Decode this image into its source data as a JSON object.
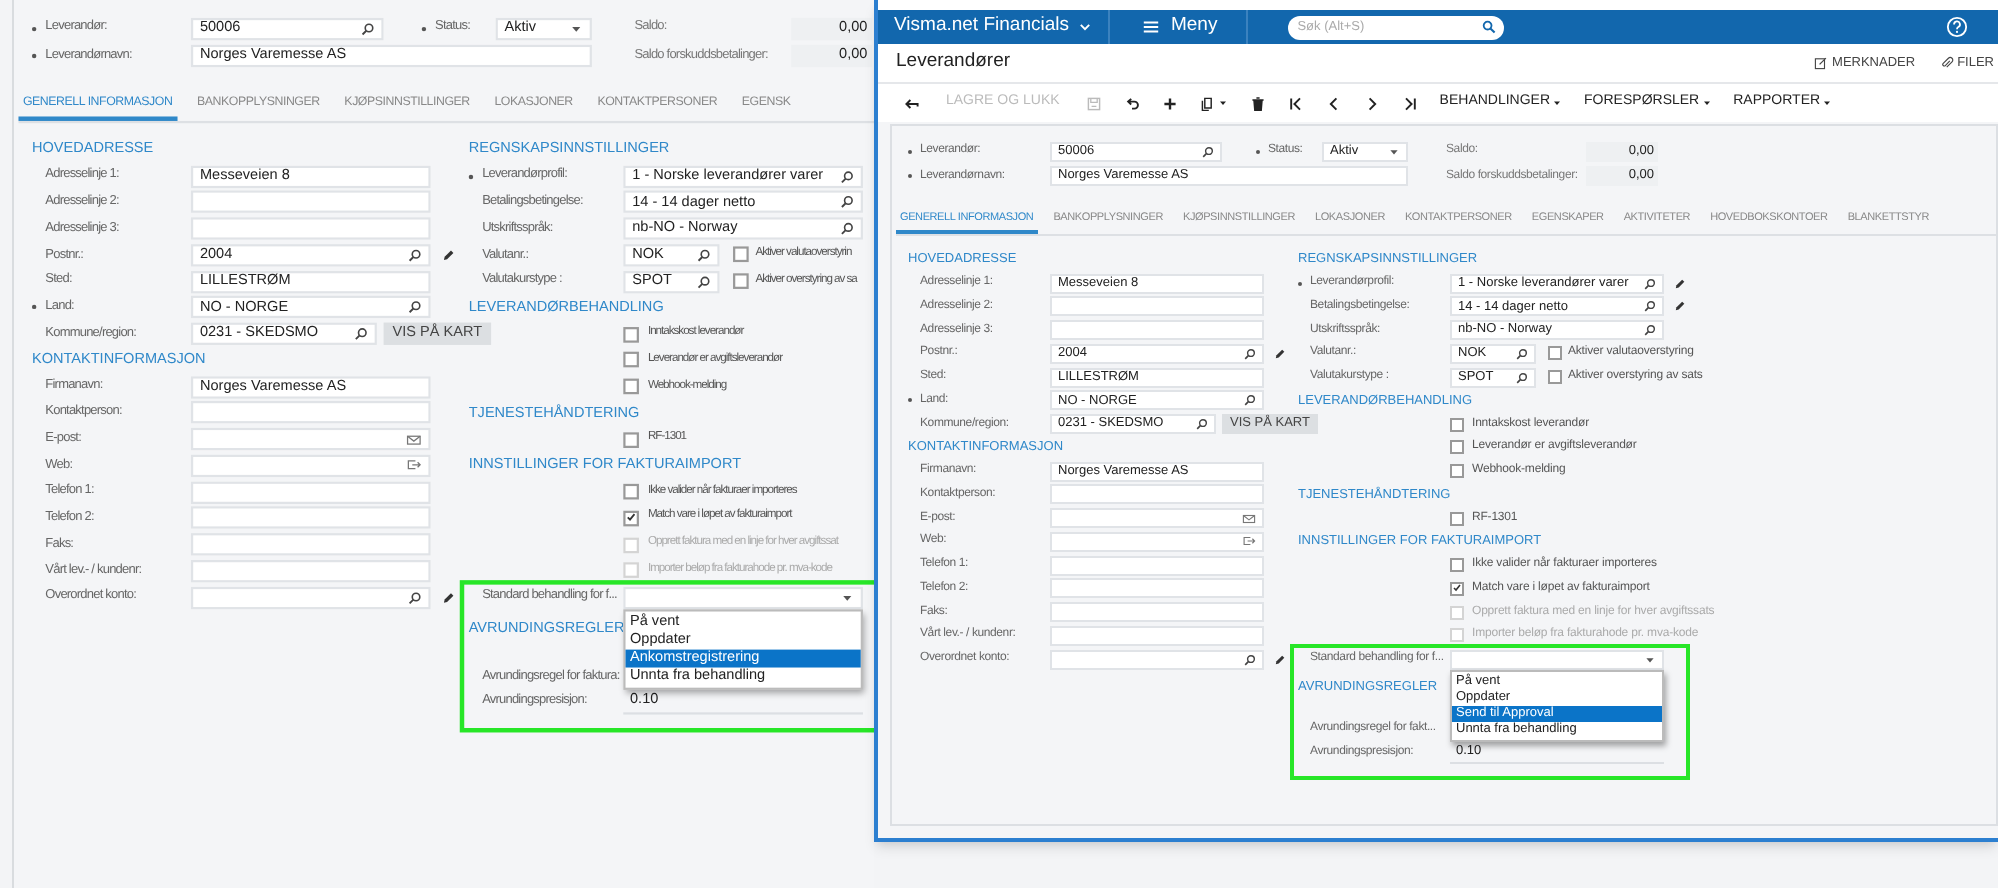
{
  "left_window": {
    "form": {
      "header": [
        [
          {
            "kind": "lookup",
            "label": "Leverandør:",
            "required": true,
            "value": "50006"
          },
          {
            "kind": "select",
            "label": "Status:",
            "required": true,
            "value": "Aktiv"
          },
          {
            "kind": "amount",
            "label": "Saldo:",
            "value": "0,00"
          }
        ],
        [
          {
            "kind": "wide",
            "label": "Leverandørnavn:",
            "required": true,
            "value": "Norges Varemesse AS"
          },
          {
            "kind": "amount",
            "label": "Saldo forskuddsbetalinger:",
            "value": "0,00"
          }
        ]
      ],
      "tabs": [
        {
          "label": "GENERELL INFORMASJON",
          "selected": true
        },
        {
          "label": "BANKOPPLYSNINGER",
          "selected": false
        },
        {
          "label": "KJØPSINNSTILLINGER",
          "selected": false
        },
        {
          "label": "LOKASJONER",
          "selected": false
        },
        {
          "label": "KONTAKTPERSONER",
          "selected": false
        },
        {
          "label": "EGENSK",
          "selected": false
        }
      ],
      "columns": [
        [
          {
            "kind": "title",
            "text": "HOVEDADRESSE"
          },
          {
            "kind": "text",
            "label": "Adresselinje 1:",
            "value": "Messeveien 8"
          },
          {
            "kind": "text",
            "label": "Adresselinje 2:"
          },
          {
            "kind": "text",
            "label": "Adresselinje 3:"
          },
          {
            "kind": "lookup",
            "label": "Postnr.:",
            "value": "2004",
            "edit": true
          },
          {
            "kind": "text",
            "label": "Sted:",
            "value": "LILLESTRØM"
          },
          {
            "kind": "lookup",
            "label": "Land:",
            "required": true,
            "value": "NO - NORGE"
          },
          {
            "kind": "lookup",
            "label": "Kommune/region:",
            "value": "0231 - SKEDSMO",
            "button": "VIS PÅ KART"
          },
          {
            "kind": "title",
            "text": "KONTAKTINFORMASJON"
          },
          {
            "kind": "text",
            "label": "Firmanavn:",
            "value": "Norges Varemesse AS"
          },
          {
            "kind": "text",
            "label": "Kontaktperson:"
          },
          {
            "kind": "email",
            "label": "E-post:"
          },
          {
            "kind": "web",
            "label": "Web:"
          },
          {
            "kind": "text",
            "label": "Telefon 1:"
          },
          {
            "kind": "text",
            "label": "Telefon 2:"
          },
          {
            "kind": "text",
            "label": "Faks:"
          },
          {
            "kind": "text",
            "label": "Vårt lev.- / kundenr:"
          },
          {
            "kind": "lookup",
            "label": "Overordnet konto:",
            "edit": true
          }
        ],
        [
          {
            "kind": "title",
            "text": "REGNSKAPSINNSTILLINGER"
          },
          {
            "kind": "lookup",
            "label": "Leverandørprofil:",
            "required": true,
            "value": "1 - Norske leverandører varer"
          },
          {
            "kind": "lookup",
            "label": "Betalingsbetingelse:",
            "value": "14 - 14 dager netto"
          },
          {
            "kind": "lookup",
            "label": "Utskriftsspråk:",
            "value": "nb-NO - Norway"
          },
          {
            "kind": "lookup",
            "label": "Valutanr.:",
            "value": "NOK",
            "check": {
              "label": "Aktiver valutaoverstyrin",
              "checked": false
            }
          },
          {
            "kind": "lookup",
            "label": "Valutakurstype :",
            "value": "SPOT",
            "check": {
              "label": "Aktiver overstyring av sa",
              "checked": false
            }
          },
          {
            "kind": "title",
            "text": "LEVERANDØRBEHANDLING"
          },
          {
            "kind": "checkbox",
            "label": "Inntakskost leverandør",
            "checked": false,
            "disabled": false
          },
          {
            "kind": "checkbox",
            "label": "Leverandør er avgiftsleverandør",
            "checked": false,
            "disabled": false
          },
          {
            "kind": "checkbox",
            "label": "Webhook-melding",
            "checked": false,
            "disabled": false
          },
          {
            "kind": "title",
            "text": "TJENESTEHÅNDTERING"
          },
          {
            "kind": "checkbox",
            "label": "RF-1301",
            "checked": false,
            "disabled": false
          },
          {
            "kind": "title",
            "text": "INNSTILLINGER FOR FAKTURAIMPORT"
          },
          {
            "kind": "checkbox",
            "label": "Ikke valider når fakturaer importeres",
            "checked": false,
            "disabled": false
          },
          {
            "kind": "checkbox",
            "label": "Match vare i løpet av fakturaimport",
            "checked": true,
            "disabled": false
          },
          {
            "kind": "checkbox",
            "label": "Opprett faktura med en linje for hver avgiftssat",
            "checked": false,
            "disabled": true
          },
          {
            "kind": "checkbox",
            "label": "Importer beløp fra fakturahode pr. mva-kode",
            "checked": false,
            "disabled": true
          },
          {
            "kind": "select",
            "label": "Standard behandling for f...",
            "highlighted": true,
            "options": [
              {
                "label": "På vent",
                "selected": false
              },
              {
                "label": "Oppdater",
                "selected": false
              },
              {
                "label": "Ankomstregistrering",
                "selected": true
              },
              {
                "label": "Unnta fra behandling",
                "selected": false
              }
            ]
          },
          {
            "kind": "title_spaced",
            "text": "AVRUNDINGSREGLER",
            "highlighted": true
          },
          {
            "kind": "label_only",
            "label": "Avrundingsregel for faktura:",
            "highlighted": true
          },
          {
            "kind": "readonly",
            "label": "Avrundingspresisjon:",
            "value": "0.10",
            "highlighted": true
          }
        ]
      ]
    }
  },
  "right_window": {
    "app_bar": {
      "product": "Visma.net Financials",
      "menu": "Meny",
      "search_placeholder": "Søk (Alt+S)"
    },
    "page_title": "Leverandører",
    "page_actions": [
      {
        "kind": "notes",
        "label": "MERKNADER"
      },
      {
        "kind": "files",
        "label": "FILER"
      }
    ],
    "toolbar": [
      {
        "kind": "back",
        "disabled": false
      },
      {
        "kind": "text",
        "label": "LAGRE OG LUKK",
        "disabled": true
      },
      {
        "kind": "save",
        "disabled": true
      },
      {
        "kind": "undo",
        "disabled": false
      },
      {
        "kind": "add",
        "disabled": false
      },
      {
        "kind": "copy",
        "disabled": false
      },
      {
        "kind": "delete",
        "disabled": false
      },
      {
        "kind": "first",
        "disabled": false
      },
      {
        "kind": "prev",
        "disabled": false
      },
      {
        "kind": "next",
        "disabled": false
      },
      {
        "kind": "last",
        "disabled": false
      },
      {
        "kind": "menu",
        "label": "BEHANDLINGER",
        "disabled": false
      },
      {
        "kind": "menu",
        "label": "FORESPØRSLER",
        "disabled": false
      },
      {
        "kind": "menu",
        "label": "RAPPORTER",
        "disabled": false
      }
    ],
    "form": {
      "header": [
        [
          {
            "kind": "lookup",
            "label": "Leverandør:",
            "required": true,
            "value": "50006"
          },
          {
            "kind": "select",
            "label": "Status:",
            "required": true,
            "value": "Aktiv"
          },
          {
            "kind": "amount",
            "label": "Saldo:",
            "value": "0,00"
          }
        ],
        [
          {
            "kind": "wide",
            "label": "Leverandørnavn:",
            "required": true,
            "value": "Norges Varemesse AS"
          },
          {
            "kind": "amount",
            "label": "Saldo forskuddsbetalinger:",
            "value": "0,00"
          }
        ]
      ],
      "tabs": [
        {
          "label": "GENERELL INFORMASJON",
          "selected": true
        },
        {
          "label": "BANKOPPLYSNINGER",
          "selected": false
        },
        {
          "label": "KJØPSINNSTILLINGER",
          "selected": false
        },
        {
          "label": "LOKASJONER",
          "selected": false
        },
        {
          "label": "KONTAKTPERSONER",
          "selected": false
        },
        {
          "label": "EGENSKAPER",
          "selected": false
        },
        {
          "label": "AKTIVITETER",
          "selected": false
        },
        {
          "label": "HOVEDBOKSKONTOER",
          "selected": false
        },
        {
          "label": "BLANKETTSTYR",
          "selected": false
        }
      ],
      "columns": [
        [
          {
            "kind": "title",
            "text": "HOVEDADRESSE"
          },
          {
            "kind": "text",
            "label": "Adresselinje 1:",
            "value": "Messeveien 8"
          },
          {
            "kind": "text",
            "label": "Adresselinje 2:"
          },
          {
            "kind": "text",
            "label": "Adresselinje 3:"
          },
          {
            "kind": "lookup",
            "label": "Postnr.:",
            "value": "2004",
            "edit": true
          },
          {
            "kind": "text",
            "label": "Sted:",
            "value": "LILLESTRØM"
          },
          {
            "kind": "lookup",
            "label": "Land:",
            "required": true,
            "value": "NO - NORGE"
          },
          {
            "kind": "lookup",
            "label": "Kommune/region:",
            "value": "0231 - SKEDSMO",
            "button": "VIS PÅ KART"
          },
          {
            "kind": "title",
            "text": "KONTAKTINFORMASJON"
          },
          {
            "kind": "text",
            "label": "Firmanavn:",
            "value": "Norges Varemesse AS"
          },
          {
            "kind": "text",
            "label": "Kontaktperson:"
          },
          {
            "kind": "email",
            "label": "E-post:"
          },
          {
            "kind": "web",
            "label": "Web:"
          },
          {
            "kind": "text",
            "label": "Telefon 1:"
          },
          {
            "kind": "text",
            "label": "Telefon 2:"
          },
          {
            "kind": "text",
            "label": "Faks:"
          },
          {
            "kind": "text",
            "label": "Vårt lev.- / kundenr:"
          },
          {
            "kind": "lookup",
            "label": "Overordnet konto:",
            "edit": true
          }
        ],
        [
          {
            "kind": "title",
            "text": "REGNSKAPSINNSTILLINGER"
          },
          {
            "kind": "lookup",
            "label": "Leverandørprofil:",
            "required": true,
            "value": "1 - Norske leverandører varer",
            "edit": true
          },
          {
            "kind": "lookup",
            "label": "Betalingsbetingelse:",
            "value": "14 - 14 dager netto",
            "edit": true
          },
          {
            "kind": "lookup",
            "label": "Utskriftsspråk:",
            "value": "nb-NO - Norway"
          },
          {
            "kind": "lookup",
            "label": "Valutanr.:",
            "value": "NOK",
            "check": {
              "label": "Aktiver valutaoverstyring",
              "checked": false
            }
          },
          {
            "kind": "lookup",
            "label": "Valutakurstype :",
            "value": "SPOT",
            "check": {
              "label": "Aktiver overstyring av sats",
              "checked": false
            }
          },
          {
            "kind": "title",
            "text": "LEVERANDØRBEHANDLING"
          },
          {
            "kind": "checkbox",
            "label": "Inntakskost leverandør",
            "checked": false,
            "disabled": false
          },
          {
            "kind": "checkbox",
            "label": "Leverandør er avgiftsleverandør",
            "checked": false,
            "disabled": false
          },
          {
            "kind": "checkbox",
            "label": "Webhook-melding",
            "checked": false,
            "disabled": false
          },
          {
            "kind": "title",
            "text": "TJENESTEHÅNDTERING"
          },
          {
            "kind": "checkbox",
            "label": "RF-1301",
            "checked": false,
            "disabled": false
          },
          {
            "kind": "title",
            "text": "INNSTILLINGER FOR FAKTURAIMPORT"
          },
          {
            "kind": "checkbox",
            "label": "Ikke valider når fakturaer importeres",
            "checked": false,
            "disabled": false
          },
          {
            "kind": "checkbox",
            "label": "Match vare i løpet av fakturaimport",
            "checked": true,
            "disabled": false
          },
          {
            "kind": "checkbox",
            "label": "Opprett faktura med en linje for hver avgiftssats",
            "checked": false,
            "disabled": true
          },
          {
            "kind": "checkbox",
            "label": "Importer beløp fra fakturahode pr. mva-kode",
            "checked": false,
            "disabled": true
          },
          {
            "kind": "select",
            "label": "Standard behandling for f...",
            "highlighted": true,
            "options": [
              {
                "label": "På vent",
                "selected": false
              },
              {
                "label": "Oppdater",
                "selected": false
              },
              {
                "label": "Send til Approval",
                "selected": true
              },
              {
                "label": "Unnta fra behandling",
                "selected": false
              }
            ]
          },
          {
            "kind": "title_spaced",
            "text": "AVRUNDINGSREGLER",
            "highlighted": true
          },
          {
            "kind": "label_only",
            "label": "Avrundingsregel for fakt...",
            "highlighted": true
          },
          {
            "kind": "readonly",
            "label": "Avrundingspresisjon:",
            "value": "0.10",
            "highlighted": true
          }
        ]
      ]
    }
  }
}
